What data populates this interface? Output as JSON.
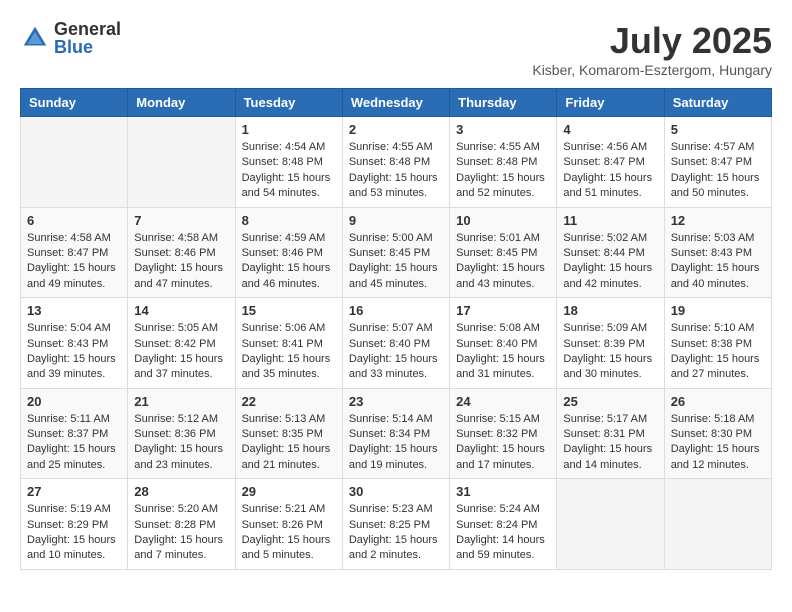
{
  "logo": {
    "general": "General",
    "blue": "Blue"
  },
  "header": {
    "month": "July 2025",
    "location": "Kisber, Komarom-Esztergom, Hungary"
  },
  "weekdays": [
    "Sunday",
    "Monday",
    "Tuesday",
    "Wednesday",
    "Thursday",
    "Friday",
    "Saturday"
  ],
  "weeks": [
    [
      {
        "day": "",
        "info": ""
      },
      {
        "day": "",
        "info": ""
      },
      {
        "day": "1",
        "info": "Sunrise: 4:54 AM\nSunset: 8:48 PM\nDaylight: 15 hours and 54 minutes."
      },
      {
        "day": "2",
        "info": "Sunrise: 4:55 AM\nSunset: 8:48 PM\nDaylight: 15 hours and 53 minutes."
      },
      {
        "day": "3",
        "info": "Sunrise: 4:55 AM\nSunset: 8:48 PM\nDaylight: 15 hours and 52 minutes."
      },
      {
        "day": "4",
        "info": "Sunrise: 4:56 AM\nSunset: 8:47 PM\nDaylight: 15 hours and 51 minutes."
      },
      {
        "day": "5",
        "info": "Sunrise: 4:57 AM\nSunset: 8:47 PM\nDaylight: 15 hours and 50 minutes."
      }
    ],
    [
      {
        "day": "6",
        "info": "Sunrise: 4:58 AM\nSunset: 8:47 PM\nDaylight: 15 hours and 49 minutes."
      },
      {
        "day": "7",
        "info": "Sunrise: 4:58 AM\nSunset: 8:46 PM\nDaylight: 15 hours and 47 minutes."
      },
      {
        "day": "8",
        "info": "Sunrise: 4:59 AM\nSunset: 8:46 PM\nDaylight: 15 hours and 46 minutes."
      },
      {
        "day": "9",
        "info": "Sunrise: 5:00 AM\nSunset: 8:45 PM\nDaylight: 15 hours and 45 minutes."
      },
      {
        "day": "10",
        "info": "Sunrise: 5:01 AM\nSunset: 8:45 PM\nDaylight: 15 hours and 43 minutes."
      },
      {
        "day": "11",
        "info": "Sunrise: 5:02 AM\nSunset: 8:44 PM\nDaylight: 15 hours and 42 minutes."
      },
      {
        "day": "12",
        "info": "Sunrise: 5:03 AM\nSunset: 8:43 PM\nDaylight: 15 hours and 40 minutes."
      }
    ],
    [
      {
        "day": "13",
        "info": "Sunrise: 5:04 AM\nSunset: 8:43 PM\nDaylight: 15 hours and 39 minutes."
      },
      {
        "day": "14",
        "info": "Sunrise: 5:05 AM\nSunset: 8:42 PM\nDaylight: 15 hours and 37 minutes."
      },
      {
        "day": "15",
        "info": "Sunrise: 5:06 AM\nSunset: 8:41 PM\nDaylight: 15 hours and 35 minutes."
      },
      {
        "day": "16",
        "info": "Sunrise: 5:07 AM\nSunset: 8:40 PM\nDaylight: 15 hours and 33 minutes."
      },
      {
        "day": "17",
        "info": "Sunrise: 5:08 AM\nSunset: 8:40 PM\nDaylight: 15 hours and 31 minutes."
      },
      {
        "day": "18",
        "info": "Sunrise: 5:09 AM\nSunset: 8:39 PM\nDaylight: 15 hours and 30 minutes."
      },
      {
        "day": "19",
        "info": "Sunrise: 5:10 AM\nSunset: 8:38 PM\nDaylight: 15 hours and 27 minutes."
      }
    ],
    [
      {
        "day": "20",
        "info": "Sunrise: 5:11 AM\nSunset: 8:37 PM\nDaylight: 15 hours and 25 minutes."
      },
      {
        "day": "21",
        "info": "Sunrise: 5:12 AM\nSunset: 8:36 PM\nDaylight: 15 hours and 23 minutes."
      },
      {
        "day": "22",
        "info": "Sunrise: 5:13 AM\nSunset: 8:35 PM\nDaylight: 15 hours and 21 minutes."
      },
      {
        "day": "23",
        "info": "Sunrise: 5:14 AM\nSunset: 8:34 PM\nDaylight: 15 hours and 19 minutes."
      },
      {
        "day": "24",
        "info": "Sunrise: 5:15 AM\nSunset: 8:32 PM\nDaylight: 15 hours and 17 minutes."
      },
      {
        "day": "25",
        "info": "Sunrise: 5:17 AM\nSunset: 8:31 PM\nDaylight: 15 hours and 14 minutes."
      },
      {
        "day": "26",
        "info": "Sunrise: 5:18 AM\nSunset: 8:30 PM\nDaylight: 15 hours and 12 minutes."
      }
    ],
    [
      {
        "day": "27",
        "info": "Sunrise: 5:19 AM\nSunset: 8:29 PM\nDaylight: 15 hours and 10 minutes."
      },
      {
        "day": "28",
        "info": "Sunrise: 5:20 AM\nSunset: 8:28 PM\nDaylight: 15 hours and 7 minutes."
      },
      {
        "day": "29",
        "info": "Sunrise: 5:21 AM\nSunset: 8:26 PM\nDaylight: 15 hours and 5 minutes."
      },
      {
        "day": "30",
        "info": "Sunrise: 5:23 AM\nSunset: 8:25 PM\nDaylight: 15 hours and 2 minutes."
      },
      {
        "day": "31",
        "info": "Sunrise: 5:24 AM\nSunset: 8:24 PM\nDaylight: 14 hours and 59 minutes."
      },
      {
        "day": "",
        "info": ""
      },
      {
        "day": "",
        "info": ""
      }
    ]
  ]
}
